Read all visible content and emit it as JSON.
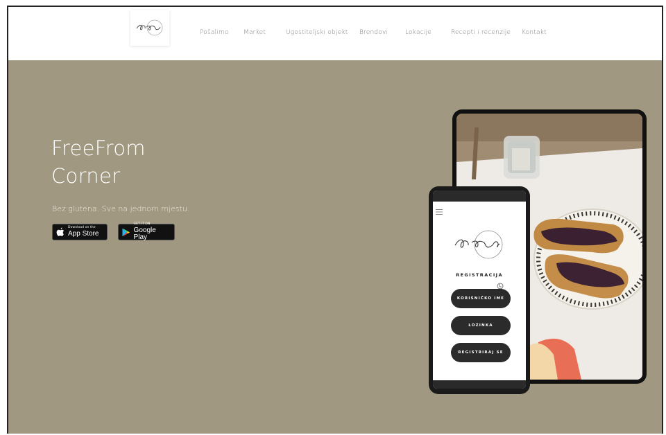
{
  "nav": {
    "logo_text": "Free From",
    "items": [
      {
        "label": "Pošalimo"
      },
      {
        "label": "Market"
      },
      {
        "label": "Ugostiteljski objekt"
      },
      {
        "label": "Brendovi"
      },
      {
        "label": "Lokacije"
      },
      {
        "label": "Recepti i recenzije"
      },
      {
        "label": "Kontakt"
      }
    ]
  },
  "hero": {
    "title_line1": "FreeFrom",
    "title_line2": "Corner",
    "subtitle": "Bez glutena. Sve na jednom mjestu.",
    "background_color": "#a09880"
  },
  "stores": {
    "appstore_small": "Download on the",
    "appstore_big": "App Store",
    "googleplay_small": "GET IT ON",
    "googleplay_big": "Google Play"
  },
  "phone_app": {
    "logo_text": "Free From",
    "register_title": "REGISTRACIJA",
    "username_button": "KORISNIČKO IME",
    "password_button": "LOZINKA",
    "register_button": "REGISTRIRAJ SE"
  },
  "colors": {
    "accent_dark": "#2b2b2b",
    "nav_text": "#777777"
  }
}
